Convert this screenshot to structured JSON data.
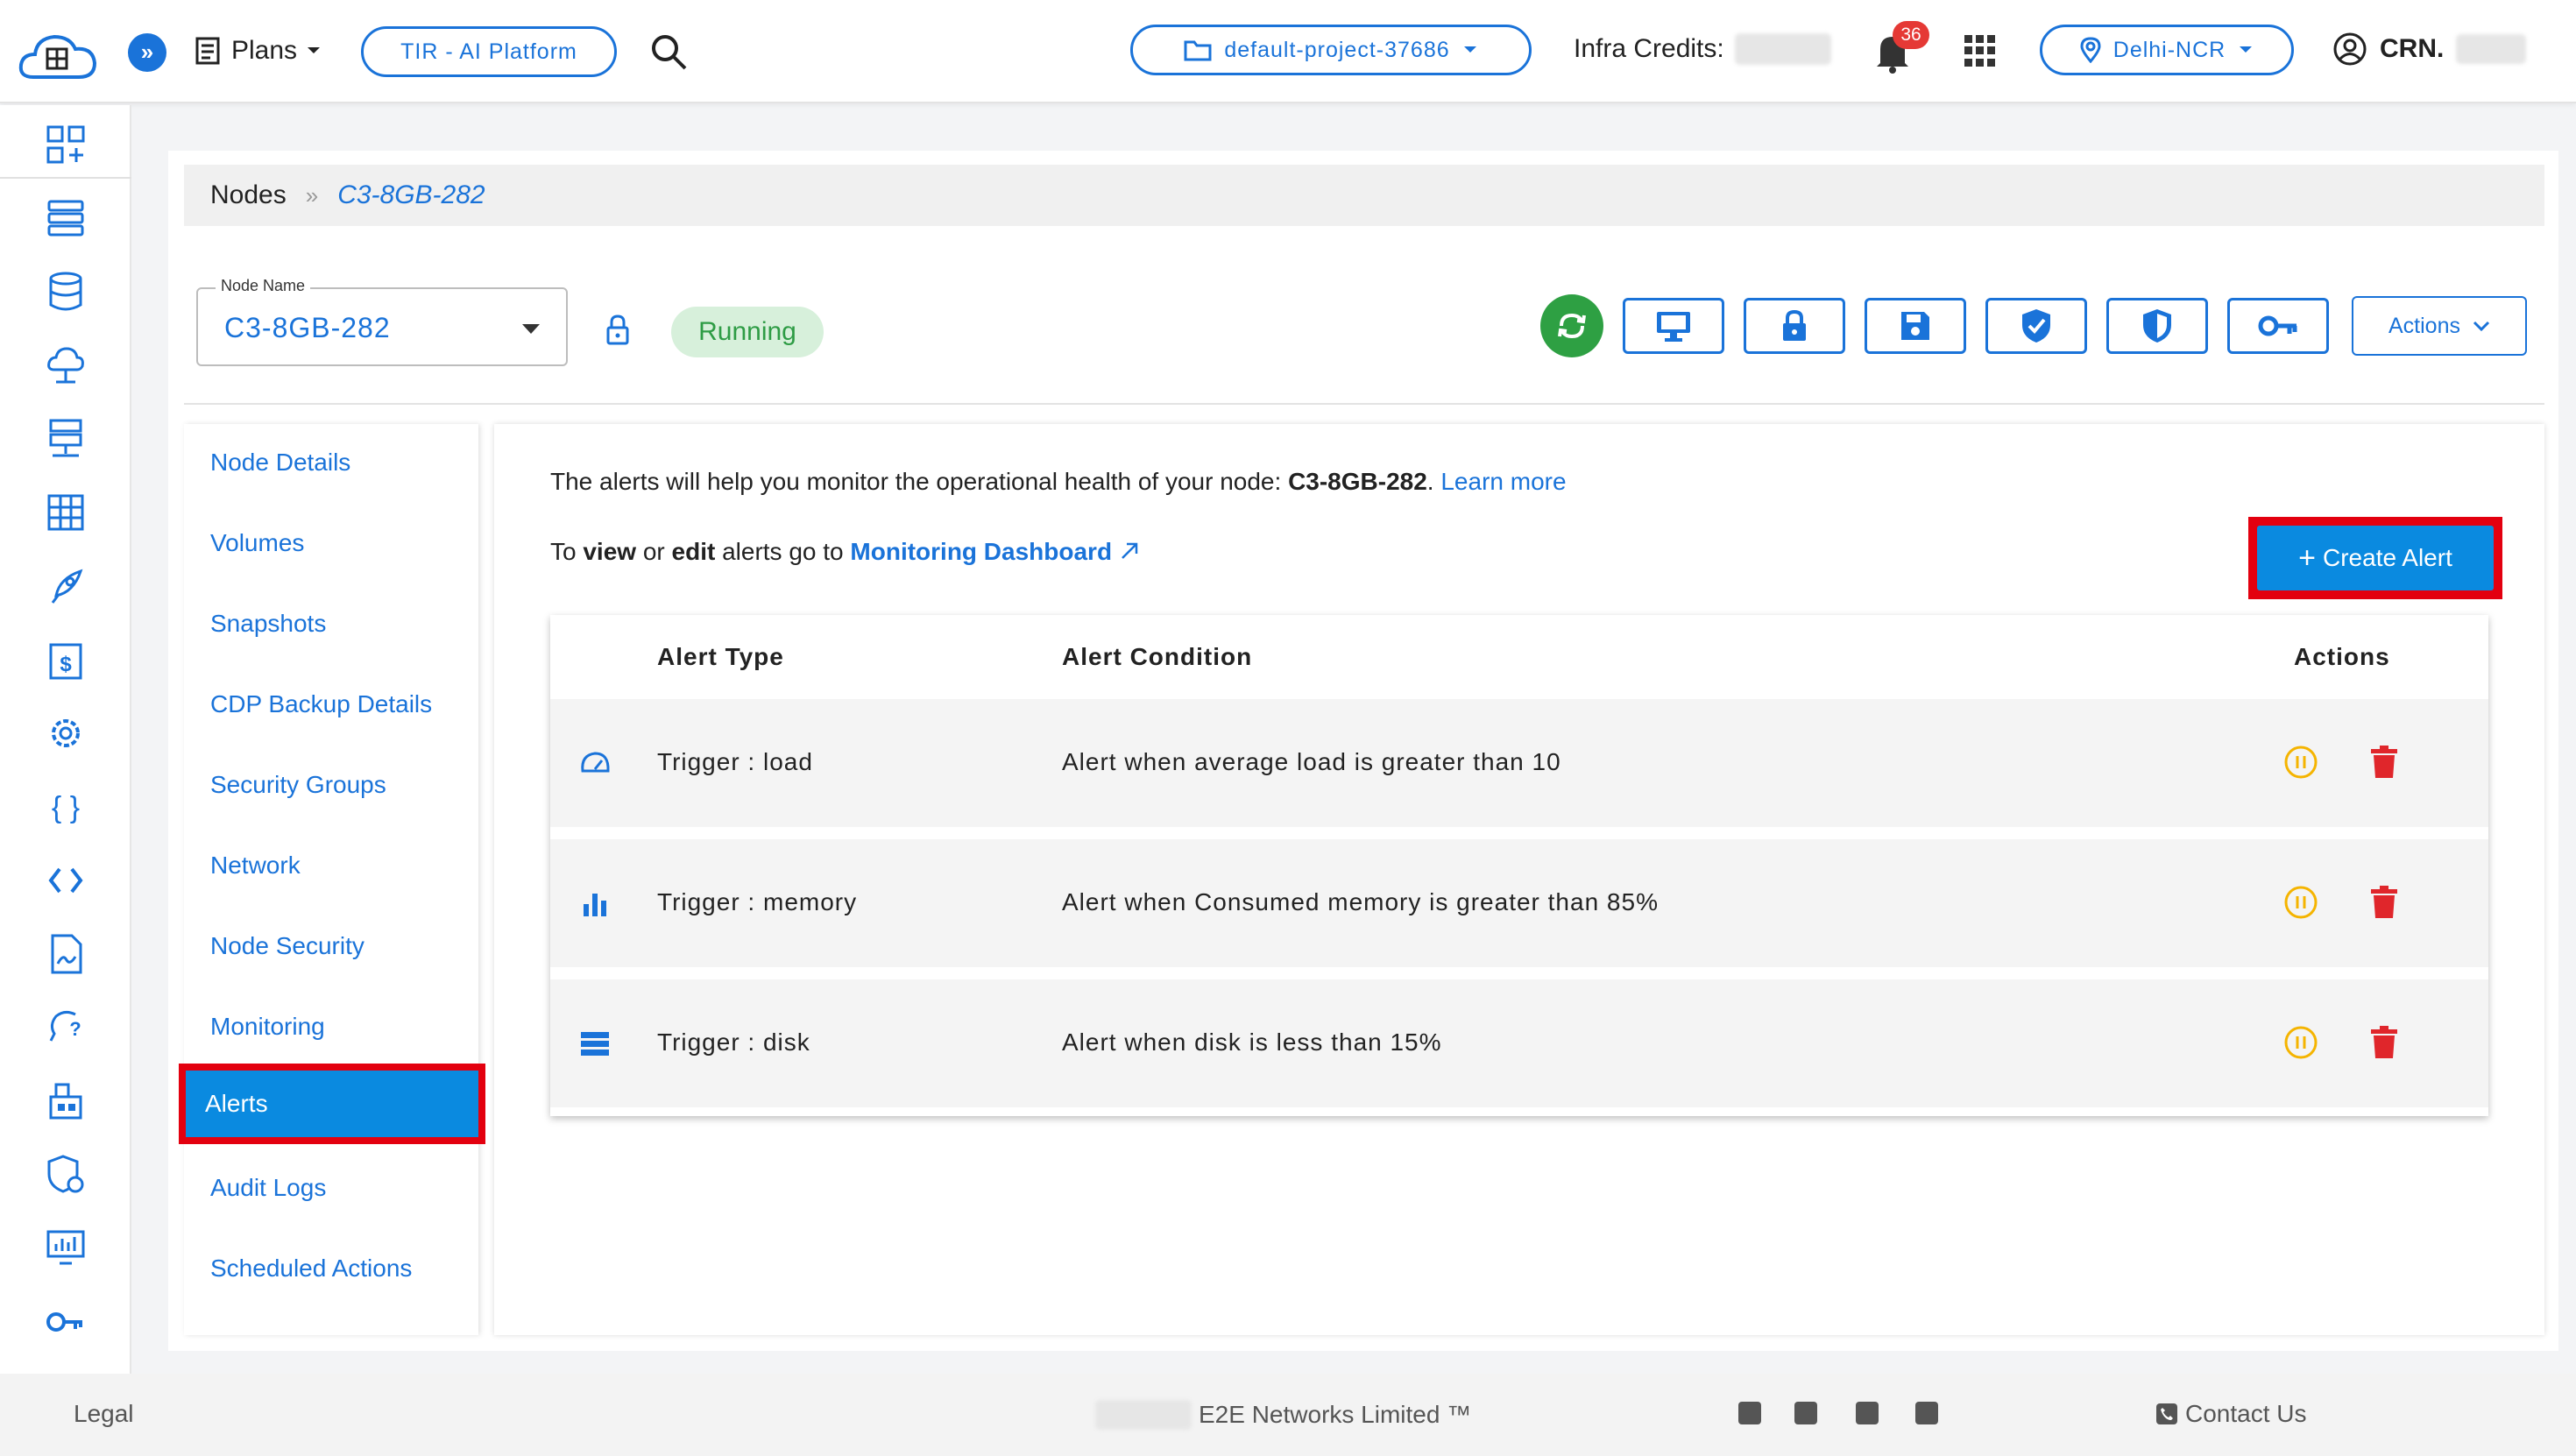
{
  "header": {
    "plans_label": "Plans",
    "platform_button": "TIR - AI Platform",
    "project_selector": "default-project-37686",
    "infra_credits_label": "Infra Credits:",
    "notification_count": "36",
    "region_selector": "Delhi-NCR",
    "account_label": "CRN."
  },
  "sidebar": {
    "icons": [
      "dashboard-icon",
      "nodes-icon",
      "database-icon",
      "cloud-upload-icon",
      "load-balancer-icon",
      "grid-icon",
      "rocket-icon",
      "billing-icon",
      "settings-icon",
      "curly-braces-icon",
      "code-icon",
      "document-icon",
      "support-icon",
      "marketplace-icon",
      "security-icon",
      "monitor-icon",
      "key-icon"
    ]
  },
  "breadcrumb": {
    "root": "Nodes",
    "separator": "»",
    "current": "C3-8GB-282"
  },
  "node": {
    "field_label": "Node Name",
    "name": "C3-8GB-282",
    "status": "Running"
  },
  "toolbar": {
    "actions_label": "Actions"
  },
  "detail_nav": {
    "items": [
      {
        "label": "Node Details"
      },
      {
        "label": "Volumes"
      },
      {
        "label": "Snapshots"
      },
      {
        "label": "CDP Backup Details"
      },
      {
        "label": "Security Groups"
      },
      {
        "label": "Network"
      },
      {
        "label": "Node Security"
      },
      {
        "label": "Monitoring"
      },
      {
        "label": "Alerts"
      },
      {
        "label": "Audit Logs"
      },
      {
        "label": "Scheduled Actions"
      }
    ],
    "active": "Alerts"
  },
  "alerts": {
    "intro_text": "The alerts will help you monitor the operational health of your node: ",
    "intro_node": "C3-8GB-282",
    "intro_period": ". ",
    "learn_more": "Learn more",
    "view_prefix": "To ",
    "view_word": "view",
    "view_or": " or ",
    "edit_word": "edit",
    "view_suffix": " alerts go to ",
    "monitoring_link": "Monitoring Dashboard",
    "create_button": "Create Alert",
    "columns": {
      "type": "Alert Type",
      "condition": "Alert Condition",
      "actions": "Actions"
    },
    "rows": [
      {
        "icon": "speedometer-icon",
        "type": "Trigger : load",
        "condition": "Alert when average load is greater than 10"
      },
      {
        "icon": "bar-chart-icon",
        "type": "Trigger : memory",
        "condition": "Alert when Consumed memory is greater than 85%"
      },
      {
        "icon": "storage-icon",
        "type": "Trigger : disk",
        "condition": "Alert when disk is less than 15%"
      }
    ]
  },
  "footer": {
    "legal": "Legal",
    "company": "E2E Networks Limited ™",
    "contact": "Contact Us"
  },
  "colors": {
    "primary": "#1a73d9",
    "active_bg": "#0a8ae0",
    "highlight": "#e3000f",
    "running_bg": "#d7f0db",
    "running_text": "#2e9c45",
    "pause": "#f5b400",
    "delete": "#e0262b"
  }
}
